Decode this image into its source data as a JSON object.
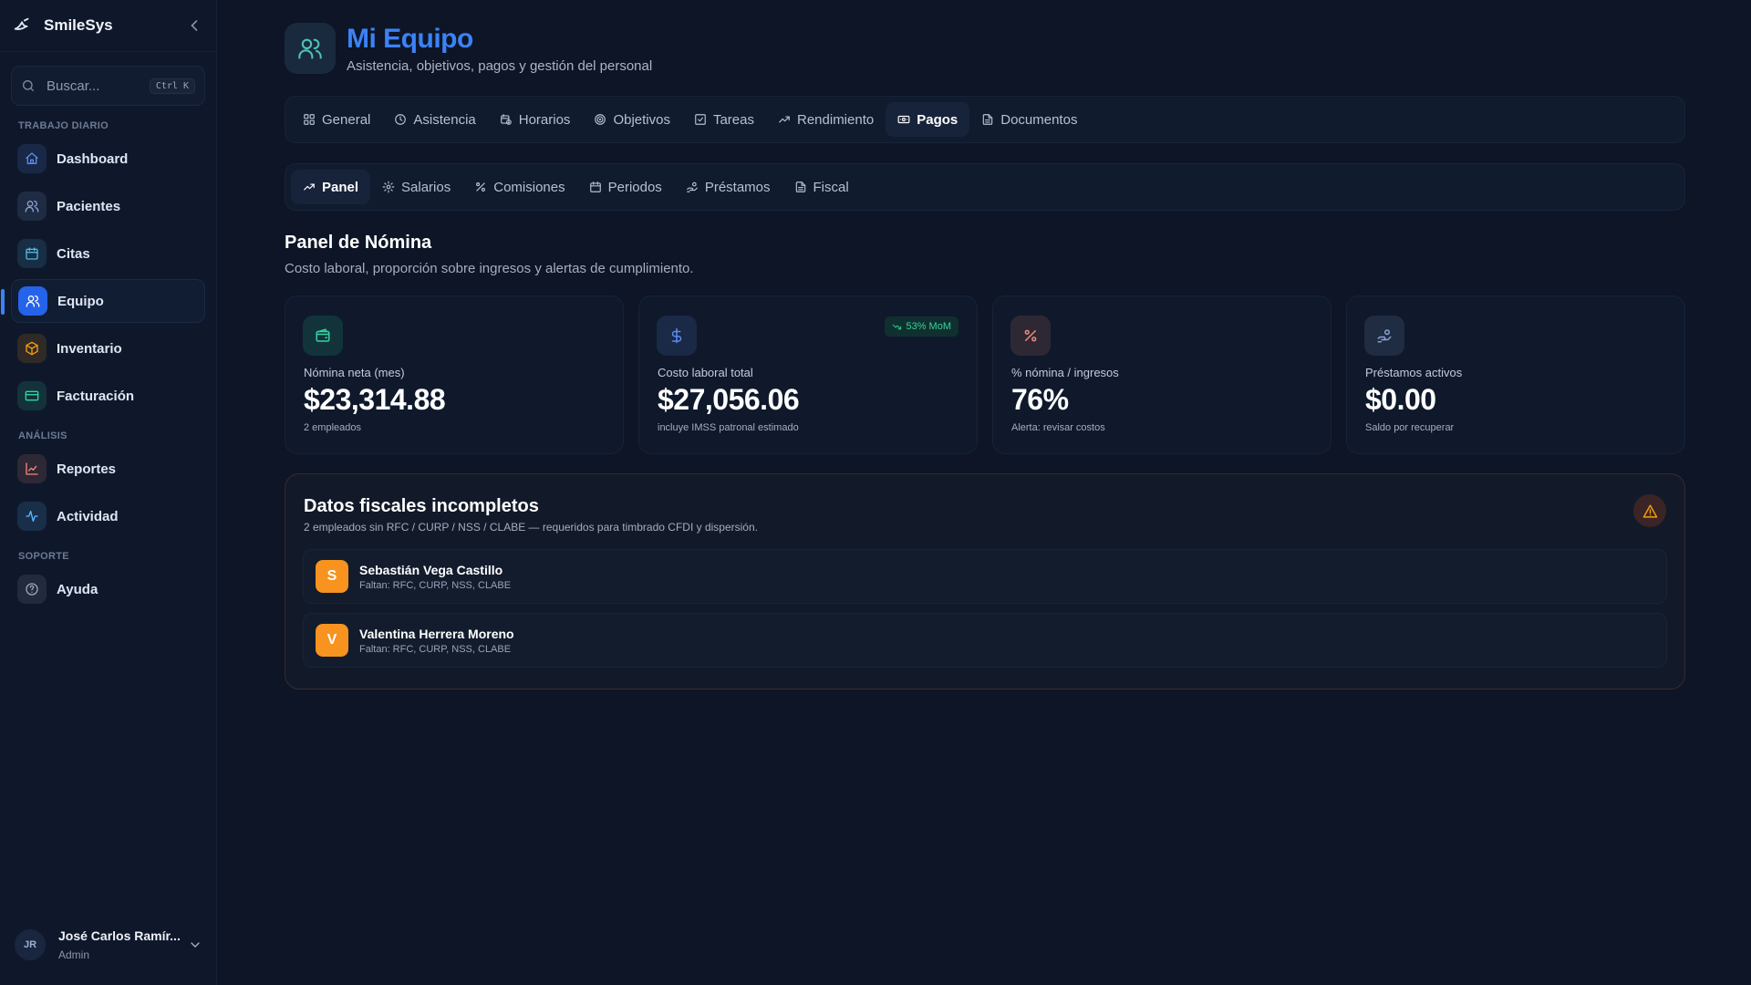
{
  "app": {
    "brand": "SmileSys"
  },
  "search": {
    "placeholder": "Buscar...",
    "shortcut": "Ctrl K"
  },
  "sidebar": {
    "sections": [
      {
        "label": "TRABAJO DIARIO"
      },
      {
        "label": "ANÁLISIS"
      },
      {
        "label": "SOPORTE"
      }
    ],
    "items": [
      {
        "label": "Dashboard",
        "icon": "home-icon",
        "color": "#5b8def"
      },
      {
        "label": "Pacientes",
        "icon": "users-icon",
        "color": "#8aa4d6"
      },
      {
        "label": "Citas",
        "icon": "calendar-icon",
        "color": "#4fb8e0"
      },
      {
        "label": "Equipo",
        "icon": "team-icon",
        "color": "#ffffff",
        "active": true
      },
      {
        "label": "Inventario",
        "icon": "box-icon",
        "color": "#f59e0b"
      },
      {
        "label": "Facturación",
        "icon": "credit-card-icon",
        "color": "#34d3a0"
      },
      {
        "label": "Reportes",
        "icon": "chart-icon",
        "color": "#f08a7a"
      },
      {
        "label": "Actividad",
        "icon": "activity-icon",
        "color": "#5bb8ff"
      },
      {
        "label": "Ayuda",
        "icon": "help-icon",
        "color": "#9aa6bb"
      }
    ]
  },
  "user": {
    "initials": "JR",
    "name": "José Carlos Ramír...",
    "role": "Admin"
  },
  "header": {
    "title": "Mi Equipo",
    "subtitle": "Asistencia, objetivos, pagos y gestión del personal"
  },
  "tabs": [
    {
      "label": "General",
      "icon": "grid-icon"
    },
    {
      "label": "Asistencia",
      "icon": "clock-icon"
    },
    {
      "label": "Horarios",
      "icon": "calendar-clock-icon"
    },
    {
      "label": "Objetivos",
      "icon": "target-icon"
    },
    {
      "label": "Tareas",
      "icon": "checkbox-icon"
    },
    {
      "label": "Rendimiento",
      "icon": "trend-up-icon"
    },
    {
      "label": "Pagos",
      "icon": "banknote-icon",
      "active": true
    },
    {
      "label": "Documentos",
      "icon": "document-icon"
    }
  ],
  "subtabs": [
    {
      "label": "Panel",
      "icon": "trend-up-icon",
      "active": true
    },
    {
      "label": "Salarios",
      "icon": "gear-icon"
    },
    {
      "label": "Comisiones",
      "icon": "percent-icon"
    },
    {
      "label": "Periodos",
      "icon": "calendar-icon"
    },
    {
      "label": "Préstamos",
      "icon": "hand-coins-icon"
    },
    {
      "label": "Fiscal",
      "icon": "document-icon"
    }
  ],
  "panel": {
    "title": "Panel de Nómina",
    "description": "Costo laboral, proporción sobre ingresos y alertas de cumplimiento."
  },
  "stats": [
    {
      "label": "Nómina neta (mes)",
      "value": "$23,314.88",
      "sub": "2 empleados",
      "icon": "wallet-icon",
      "color": "#34d3a0"
    },
    {
      "label": "Costo laboral total",
      "value": "$27,056.06",
      "sub": "incluye IMSS patronal estimado",
      "icon": "dollar-icon",
      "color": "#5b8def",
      "badge": "53% MoM"
    },
    {
      "label": "% nómina / ingresos",
      "value": "76%",
      "sub": "Alerta: revisar costos",
      "icon": "percent-icon",
      "color": "#f08a7a"
    },
    {
      "label": "Préstamos activos",
      "value": "$0.00",
      "sub": "Saldo por recuperar",
      "icon": "hand-coins-icon",
      "color": "#8aa4d6"
    }
  ],
  "alert": {
    "title": "Datos fiscales incompletos",
    "description": "2 empleados sin RFC / CURP / NSS / CLABE — requeridos para timbrado CFDI y dispersión.",
    "employees": [
      {
        "initial": "S",
        "name": "Sebastián Vega Castillo",
        "missing": "Faltan: RFC, CURP, NSS, CLABE"
      },
      {
        "initial": "V",
        "name": "Valentina Herrera Moreno",
        "missing": "Faltan: RFC, CURP, NSS, CLABE"
      }
    ]
  }
}
